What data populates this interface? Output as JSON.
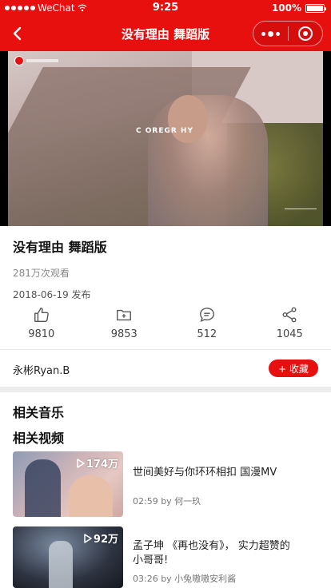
{
  "status_bar": {
    "carrier": "WeChat",
    "time": "9:25",
    "battery": "100%"
  },
  "nav": {
    "title": "没有理由 舞蹈版"
  },
  "video": {
    "overlay_text": "C OREGR  HY"
  },
  "info": {
    "title": "没有理由 舞蹈版",
    "views": "281万次观看",
    "publish_date": "2018-06-19 发布"
  },
  "actions": {
    "like_count": "9810",
    "collect_count": "9853",
    "comment_count": "512",
    "share_count": "1045"
  },
  "author": {
    "name": "永彬Ryan.B",
    "favorite_label": "+ 收藏"
  },
  "sections": {
    "related_music": "相关音乐",
    "related_videos": "相关视频"
  },
  "related_videos": [
    {
      "play_count": "174万",
      "title": "世间美好与你环环相扣 国漫MV",
      "meta": "02:59 by 何一玖"
    },
    {
      "play_count": "92万",
      "title": "孟子坤 《再也没有》， 实力超赞的小哥哥!",
      "meta": "03:26 by 小兔嗷嗷安利酱"
    }
  ],
  "colors": {
    "brand_red": "#e8100f"
  }
}
